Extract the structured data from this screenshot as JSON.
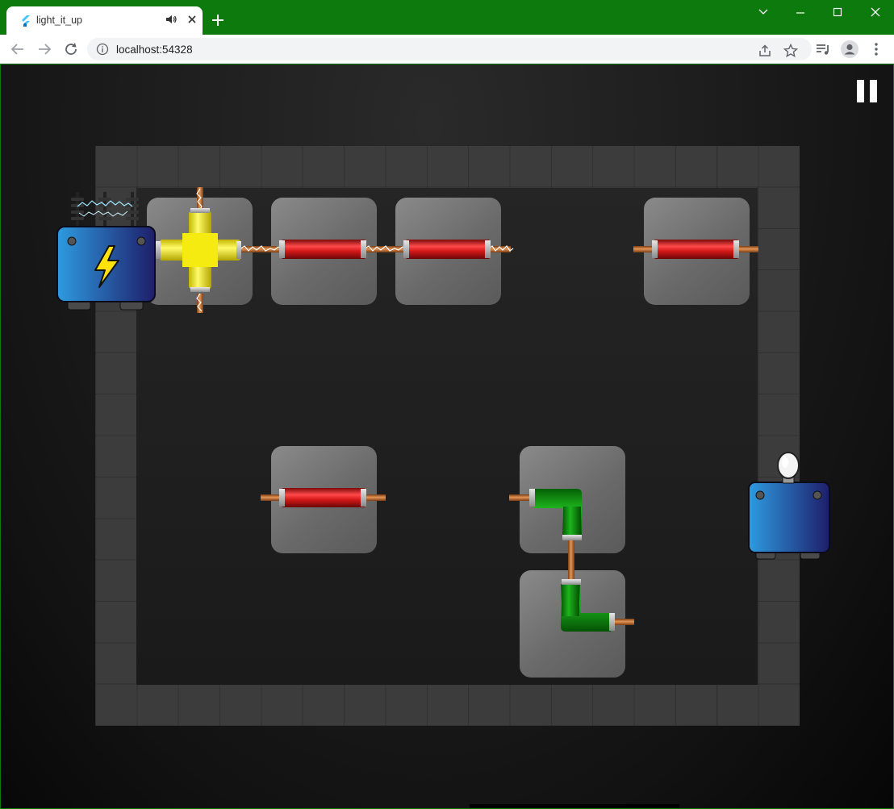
{
  "browser": {
    "tab_title": "light_it_up",
    "url": "localhost:54328",
    "theme_color": "#0c7a0c"
  },
  "icons": {
    "favicon": "flutter-icon",
    "audio": "speaker-icon",
    "close": "close-icon",
    "new_tab": "plus-icon",
    "back": "back-arrow-icon",
    "forward": "forward-arrow-icon",
    "reload": "reload-icon",
    "site_info": "info-icon",
    "share": "share-icon",
    "bookmark": "star-icon",
    "media": "media-queue-icon",
    "profile": "profile-icon",
    "menu": "kebab-menu-icon",
    "pause": "pause-icon",
    "power_source": "lightning-icon",
    "goal": "light-bulb-icon"
  },
  "game": {
    "colors": {
      "powered_cross": "#f2ea00",
      "powered_straight": "#d11a1a",
      "unpowered_corner": "#0e8f0e",
      "wire": "#b8682e",
      "source_box": "#2a8fd6",
      "bulb_box": "#2a8fd6"
    },
    "pieces": [
      {
        "type": "cross",
        "powered": true
      },
      {
        "type": "straight",
        "powered": true
      },
      {
        "type": "straight",
        "powered": true
      },
      {
        "type": "straight",
        "powered": false
      },
      {
        "type": "straight",
        "powered": false
      },
      {
        "type": "corner",
        "powered": false
      },
      {
        "type": "corner",
        "powered": false
      }
    ]
  }
}
